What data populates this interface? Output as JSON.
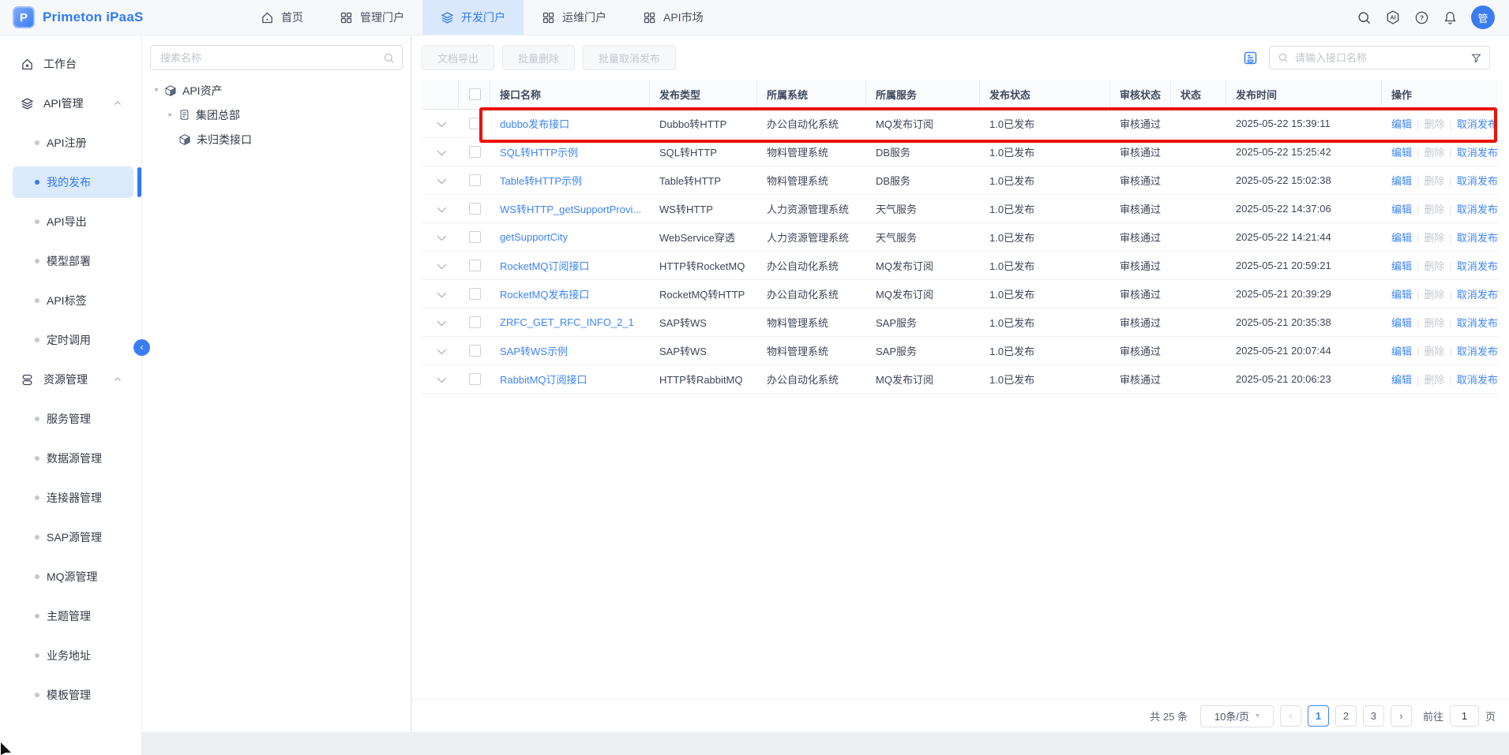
{
  "brand": {
    "name": "Primeton iPaaS",
    "logo_letter": "P"
  },
  "navbar": {
    "items": [
      {
        "label": "首页",
        "icon": "home",
        "active": false
      },
      {
        "label": "管理门户",
        "icon": "grid",
        "active": false
      },
      {
        "label": "开发门户",
        "icon": "layers",
        "active": true
      },
      {
        "label": "运维门户",
        "icon": "grid",
        "active": false
      },
      {
        "label": "API市场",
        "icon": "grid",
        "active": false
      }
    ],
    "avatar_text": "管"
  },
  "sidebar": {
    "items": [
      {
        "type": "top",
        "label": "工作台",
        "icon": "workbench"
      },
      {
        "type": "group",
        "label": "API管理",
        "icon": "layers"
      },
      {
        "type": "child",
        "label": "API注册",
        "active": false
      },
      {
        "type": "child",
        "label": "我的发布",
        "active": true
      },
      {
        "type": "child",
        "label": "API导出",
        "active": false
      },
      {
        "type": "child",
        "label": "模型部署",
        "active": false
      },
      {
        "type": "child",
        "label": "API标签",
        "active": false
      },
      {
        "type": "child",
        "label": "定时调用",
        "active": false
      },
      {
        "type": "group",
        "label": "资源管理",
        "icon": "database"
      },
      {
        "type": "child",
        "label": "服务管理",
        "active": false
      },
      {
        "type": "child",
        "label": "数据源管理",
        "active": false
      },
      {
        "type": "child",
        "label": "连接器管理",
        "active": false
      },
      {
        "type": "child",
        "label": "SAP源管理",
        "active": false
      },
      {
        "type": "child",
        "label": "MQ源管理",
        "active": false
      },
      {
        "type": "child",
        "label": "主题管理",
        "active": false
      },
      {
        "type": "child",
        "label": "业务地址",
        "active": false
      },
      {
        "type": "child",
        "label": "模板管理",
        "active": false
      }
    ]
  },
  "tree": {
    "search_placeholder": "搜索名称",
    "nodes": [
      {
        "label": "API资产",
        "icon": "cube",
        "caret": "down",
        "level": 0
      },
      {
        "label": "集团总部",
        "icon": "doc",
        "caret": "right",
        "level": 1
      },
      {
        "label": "未归类接口",
        "icon": "cube",
        "caret": "none",
        "level": 1
      }
    ]
  },
  "toolbar": {
    "buttons": [
      "文档导出",
      "批量删除",
      "批量取消发布"
    ],
    "search_placeholder": "请输入接口名称"
  },
  "table": {
    "headers": [
      "接口名称",
      "发布类型",
      "所属系统",
      "所属服务",
      "发布状态",
      "审核状态",
      "状态",
      "发布时间",
      "操作"
    ],
    "actions": [
      {
        "label": "编辑",
        "enabled": true
      },
      {
        "label": "删除",
        "enabled": false
      },
      {
        "label": "取消发布",
        "enabled": true
      }
    ],
    "rows": [
      {
        "name": "dubbo发布接口",
        "type": "Dubbo转HTTP",
        "system": "办公自动化系统",
        "service": "MQ发布订阅",
        "pub_status": "1.0已发布",
        "audit_status": "审核通过",
        "enabled": true,
        "publish_time": "2025-05-22 15:39:11",
        "highlighted": true
      },
      {
        "name": "SQL转HTTP示例",
        "type": "SQL转HTTP",
        "system": "物料管理系统",
        "service": "DB服务",
        "pub_status": "1.0已发布",
        "audit_status": "审核通过",
        "enabled": true,
        "publish_time": "2025-05-22 15:25:42",
        "highlighted": false
      },
      {
        "name": "Table转HTTP示例",
        "type": "Table转HTTP",
        "system": "物料管理系统",
        "service": "DB服务",
        "pub_status": "1.0已发布",
        "audit_status": "审核通过",
        "enabled": true,
        "publish_time": "2025-05-22 15:02:38",
        "highlighted": false
      },
      {
        "name": "WS转HTTP_getSupportProvi...",
        "type": "WS转HTTP",
        "system": "人力资源管理系统",
        "service": "天气服务",
        "pub_status": "1.0已发布",
        "audit_status": "审核通过",
        "enabled": true,
        "publish_time": "2025-05-22 14:37:06",
        "highlighted": false
      },
      {
        "name": "getSupportCity",
        "type": "WebService穿透",
        "system": "人力资源管理系统",
        "service": "天气服务",
        "pub_status": "1.0已发布",
        "audit_status": "审核通过",
        "enabled": true,
        "publish_time": "2025-05-22 14:21:44",
        "highlighted": false
      },
      {
        "name": "RocketMQ订阅接口",
        "type": "HTTP转RocketMQ",
        "system": "办公自动化系统",
        "service": "MQ发布订阅",
        "pub_status": "1.0已发布",
        "audit_status": "审核通过",
        "enabled": true,
        "publish_time": "2025-05-21 20:59:21",
        "highlighted": false
      },
      {
        "name": "RocketMQ发布接口",
        "type": "RocketMQ转HTTP",
        "system": "办公自动化系统",
        "service": "MQ发布订阅",
        "pub_status": "1.0已发布",
        "audit_status": "审核通过",
        "enabled": true,
        "publish_time": "2025-05-21 20:39:29",
        "highlighted": false
      },
      {
        "name": "ZRFC_GET_RFC_INFO_2_1",
        "type": "SAP转WS",
        "system": "物料管理系统",
        "service": "SAP服务",
        "pub_status": "1.0已发布",
        "audit_status": "审核通过",
        "enabled": true,
        "publish_time": "2025-05-21 20:35:38",
        "highlighted": false
      },
      {
        "name": "SAP转WS示例",
        "type": "SAP转WS",
        "system": "物料管理系统",
        "service": "SAP服务",
        "pub_status": "1.0已发布",
        "audit_status": "审核通过",
        "enabled": true,
        "publish_time": "2025-05-21 20:07:44",
        "highlighted": false
      },
      {
        "name": "RabbitMQ订阅接口",
        "type": "HTTP转RabbitMQ",
        "system": "办公自动化系统",
        "service": "MQ发布订阅",
        "pub_status": "1.0已发布",
        "audit_status": "审核通过",
        "enabled": true,
        "publish_time": "2025-05-21 20:06:23",
        "highlighted": false
      }
    ]
  },
  "pagination": {
    "total_text": "共 25 条",
    "page_size": "10条/页",
    "pages": [
      "1",
      "2",
      "3"
    ],
    "current_page": "1",
    "goto_label": "前往",
    "goto_value": "1",
    "unit_label": "页"
  },
  "colors": {
    "accent": "#3a7df0",
    "link": "#3d84f7",
    "toggle_on": "#18a1f6",
    "highlight_red": "#ec1205",
    "active_nav_bg": "#d9e8fc",
    "active_side_bg": "#dcebfc"
  }
}
